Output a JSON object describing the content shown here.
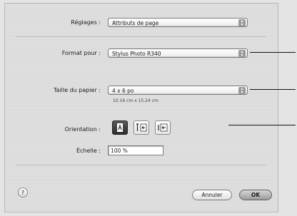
{
  "dialog": {
    "settings_label": "Réglages :",
    "settings_value": "Attributs de page",
    "format_label": "Format pour :",
    "format_value": "Stylus Photo R340",
    "paper_label": "Taille du papier :",
    "paper_value": "4 x 6 po",
    "paper_dims": "10.16 cm x 15.24 cm",
    "orientation_label": "Orientation :",
    "scale_label": "Échelle :",
    "scale_value": "100 %",
    "help_glyph": "?",
    "cancel_label": "Annuler",
    "ok_label": "OK"
  },
  "icons": {
    "popup_arrows": "updown-arrows-icon",
    "orientation_options": [
      "portrait-icon",
      "landscape-left-icon",
      "landscape-right-icon"
    ]
  },
  "state": {
    "selected_orientation": "portrait"
  }
}
